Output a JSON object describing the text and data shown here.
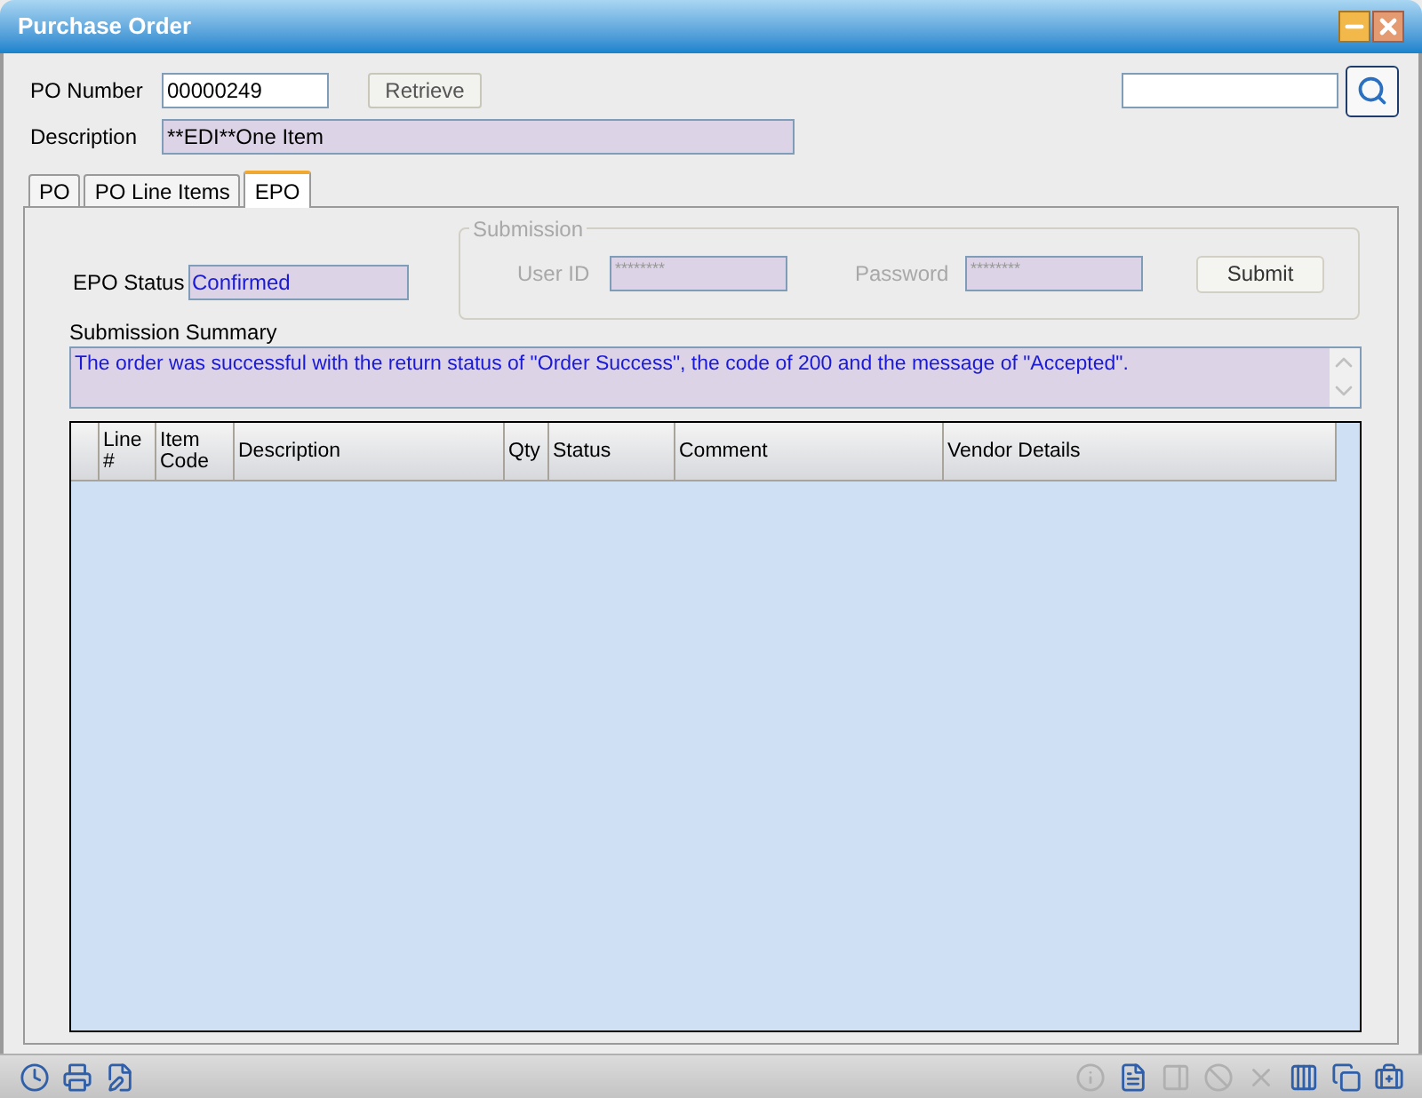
{
  "window": {
    "title": "Purchase Order"
  },
  "po_number": {
    "label": "PO Number",
    "value": "00000249"
  },
  "retrieve_button": {
    "label": "Retrieve"
  },
  "search": {
    "kind": "empty"
  },
  "description": {
    "label": "Description",
    "value": "**EDI**One Item"
  },
  "tabs": [
    {
      "label": "PO",
      "selected": false
    },
    {
      "label": "PO Line Items",
      "selected": false
    },
    {
      "label": "EPO",
      "selected": true
    }
  ],
  "epo_status": {
    "label": "EPO Status",
    "value": "Confirmed"
  },
  "submission": {
    "title": "Submission",
    "disabled": true,
    "user_id": {
      "label": "User ID",
      "value": "********"
    },
    "password": {
      "label": "Password",
      "value": "********"
    },
    "submit": "Submit"
  },
  "summary": {
    "label": "Submission Summary",
    "value": "The order was successful with the return status of \"Order Success\", the code of 200 and the message of \"Accepted\"."
  },
  "table": {
    "columns": [
      "",
      "Line #",
      "Item Code",
      "Description",
      "Qty",
      "Status",
      "Comment",
      "Vendor Details"
    ]
  },
  "toolbar_left": [
    {
      "kind": "clock",
      "disabled": false
    },
    {
      "kind": "printer",
      "disabled": false
    },
    {
      "kind": "edit",
      "disabled": false
    }
  ],
  "toolbar_right": [
    {
      "kind": "info",
      "disabled": true
    },
    {
      "kind": "document",
      "disabled": false
    },
    {
      "kind": "panel",
      "disabled": true
    },
    {
      "kind": "ban",
      "disabled": true
    },
    {
      "kind": "delete",
      "disabled": true
    },
    {
      "kind": "columns",
      "disabled": false
    },
    {
      "kind": "copy",
      "disabled": false
    },
    {
      "kind": "kit",
      "disabled": false
    }
  ]
}
